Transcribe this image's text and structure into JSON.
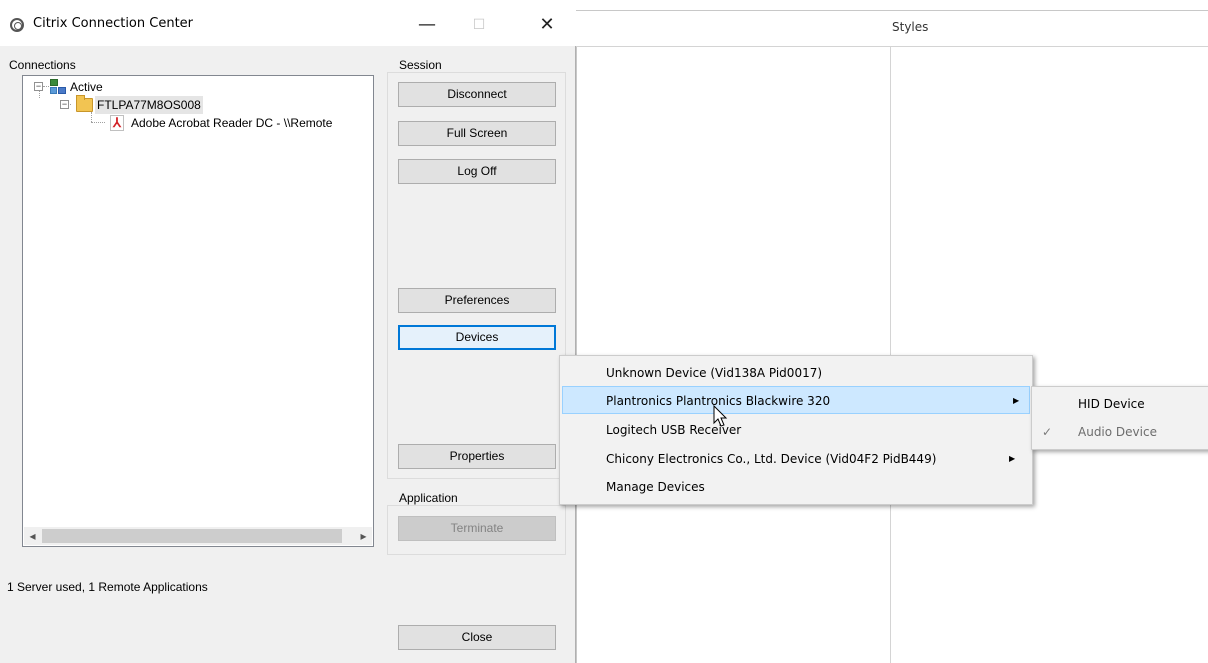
{
  "window": {
    "title": "Citrix Connection Center",
    "minimize_glyph": "—",
    "maximize_glyph": "☐",
    "close_glyph": "✕"
  },
  "connections": {
    "label": "Connections",
    "tree": {
      "root": "Active",
      "server": "FTLPA77M8OS008",
      "app": "Adobe Acrobat Reader DC - \\\\Remote"
    }
  },
  "session": {
    "label": "Session",
    "buttons": {
      "disconnect": "Disconnect",
      "full_screen": "Full Screen",
      "log_off": "Log Off",
      "preferences": "Preferences",
      "devices": "Devices",
      "properties": "Properties"
    }
  },
  "application": {
    "label": "Application",
    "terminate": "Terminate"
  },
  "status_text": "1 Server used, 1 Remote Applications",
  "close_button": "Close",
  "background_app": {
    "header_label": "Styles"
  },
  "devices_menu": {
    "items": [
      {
        "label": "Unknown Device (Vid138A Pid0017)"
      },
      {
        "label": "Plantronics Plantronics Blackwire 320",
        "submenu": true
      },
      {
        "label": "Logitech USB Receiver"
      },
      {
        "label": "Chicony Electronics Co., Ltd. Device (Vid04F2 PidB449)",
        "submenu": true
      },
      {
        "label": "Manage Devices"
      }
    ]
  },
  "device_submenu": {
    "items": [
      {
        "label": "HID Device",
        "checked": false,
        "enabled": true
      },
      {
        "label": "Audio Device",
        "checked": true,
        "enabled": false
      }
    ]
  },
  "icons": {
    "app": "citrix-logo-icon",
    "network": "network-icon",
    "folder": "folder-icon",
    "pdf": "pdf-icon",
    "scroll_left": "◂",
    "scroll_right": "▸",
    "submenu_arrow": "▶",
    "check": "✓"
  }
}
